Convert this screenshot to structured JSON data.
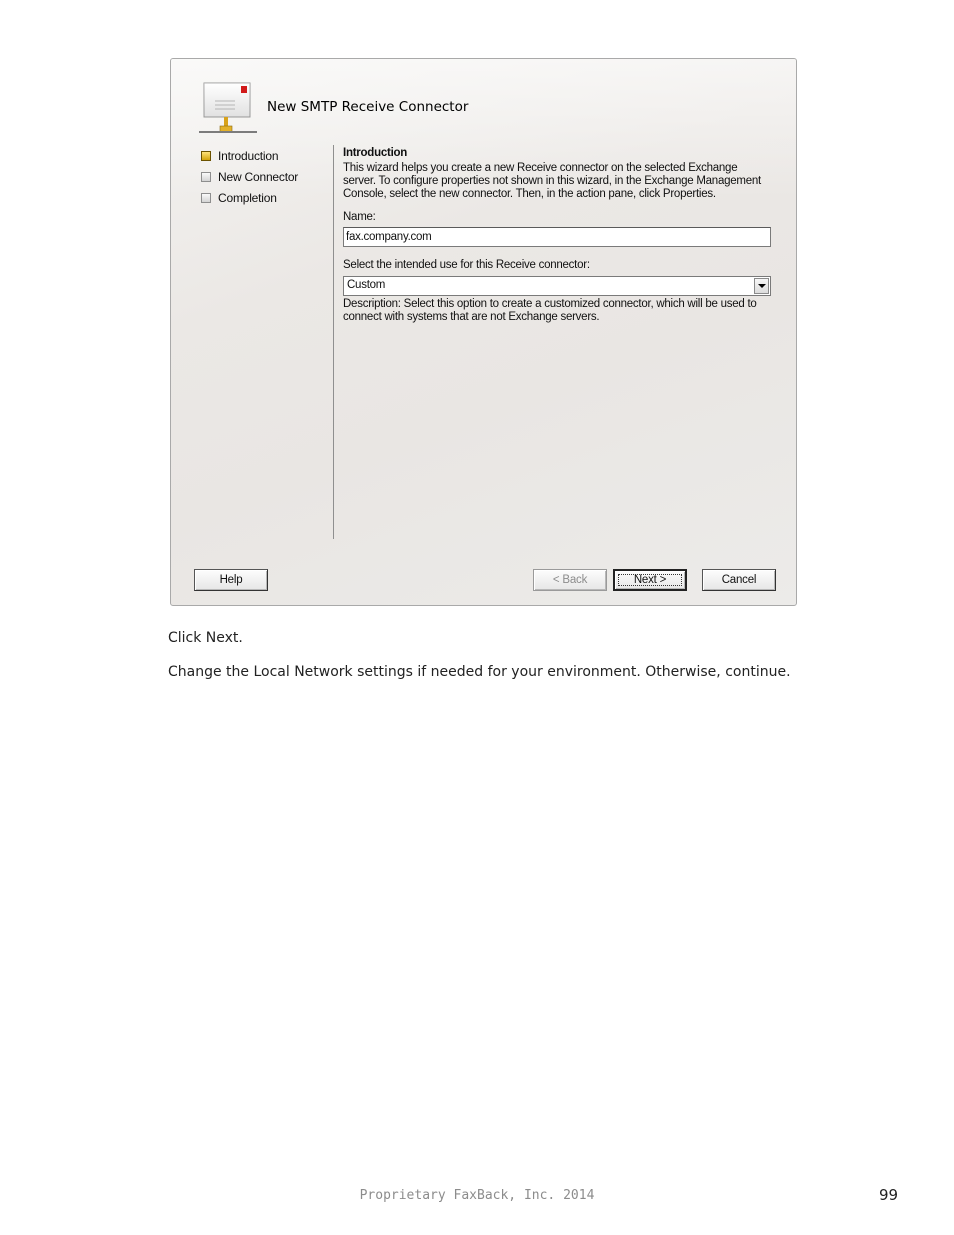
{
  "wizard": {
    "title": "New SMTP Receive Connector",
    "header_icon": "connector-envelope-icon",
    "steps": [
      {
        "label": "Introduction",
        "state": "active"
      },
      {
        "label": "New Connector",
        "state": "pending"
      },
      {
        "label": "Completion",
        "state": "pending"
      }
    ],
    "content": {
      "heading": "Introduction",
      "intro_text": "This wizard helps you create a new Receive connector on the selected Exchange server. To configure properties not shown in this wizard, in the Exchange Management Console, select the new connector. Then, in the action pane, click Properties.",
      "name_label": "Name:",
      "name_value": "fax.company.com",
      "use_label": "Select the intended use for this Receive connector:",
      "use_value": "Custom",
      "description": "Description: Select this option to create a customized connector, which will be used to connect with systems that are not Exchange servers."
    },
    "buttons": {
      "help": "Help",
      "back": "< Back",
      "next": "Next >",
      "cancel": "Cancel"
    }
  },
  "document": {
    "instruction_1": "Click Next.",
    "instruction_2": "Change the Local Network settings if needed for your environment. Otherwise, continue.",
    "footer": "Proprietary FaxBack, Inc. 2014",
    "page_number": "99"
  },
  "colors": {
    "active_step": "#e0b21a",
    "dialog_background": "#ebe8e5",
    "footer_text": "#8c8c8c"
  }
}
